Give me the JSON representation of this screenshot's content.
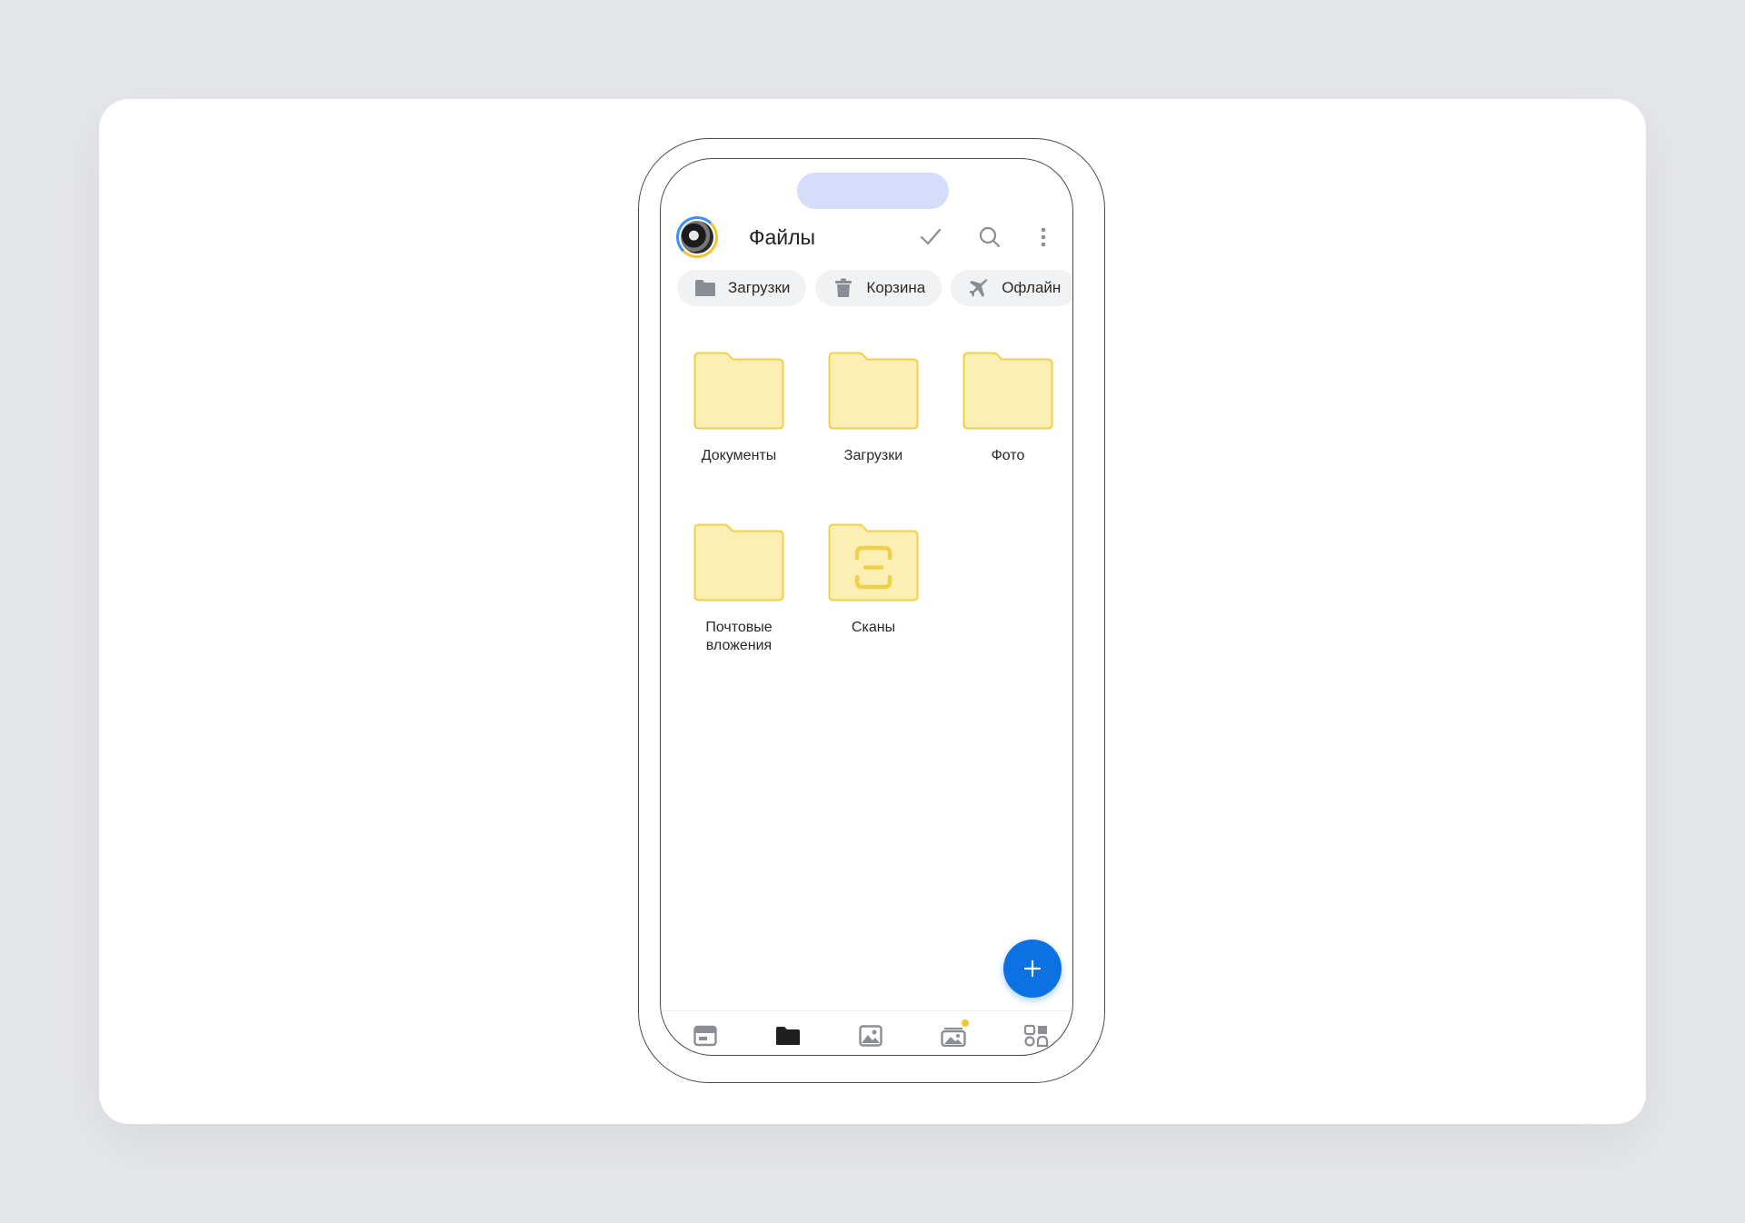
{
  "header": {
    "title": "Файлы",
    "icons": [
      "check-icon",
      "search-icon",
      "more-vertical-icon"
    ]
  },
  "chips": [
    {
      "label": "Загрузки",
      "icon": "folder-icon"
    },
    {
      "label": "Корзина",
      "icon": "trash-icon"
    },
    {
      "label": "Офлайн",
      "icon": "airplane-icon"
    }
  ],
  "folders": [
    {
      "label": "Документы"
    },
    {
      "label": "Загрузки"
    },
    {
      "label": "Фото"
    },
    {
      "label": "Почтовые вложения"
    },
    {
      "label": "Сканы",
      "badge": "scan-icon"
    }
  ],
  "fab": {
    "icon": "plus-icon"
  },
  "tabbar": {
    "items": [
      {
        "icon": "feed-icon",
        "active": false
      },
      {
        "icon": "files-folder-icon",
        "active": true
      },
      {
        "icon": "photos-icon",
        "active": false
      },
      {
        "icon": "albums-icon",
        "active": false,
        "notification": true
      },
      {
        "icon": "services-icon",
        "active": false
      }
    ]
  },
  "colors": {
    "folder_fill": "#fcefb4",
    "folder_stroke": "#f0d048",
    "accent": "#0c72e3",
    "notch": "#d6ddfb",
    "chip_bg": "#f1f2f4",
    "icon_gray": "#8a8d93",
    "notification_dot": "#f4c430"
  }
}
